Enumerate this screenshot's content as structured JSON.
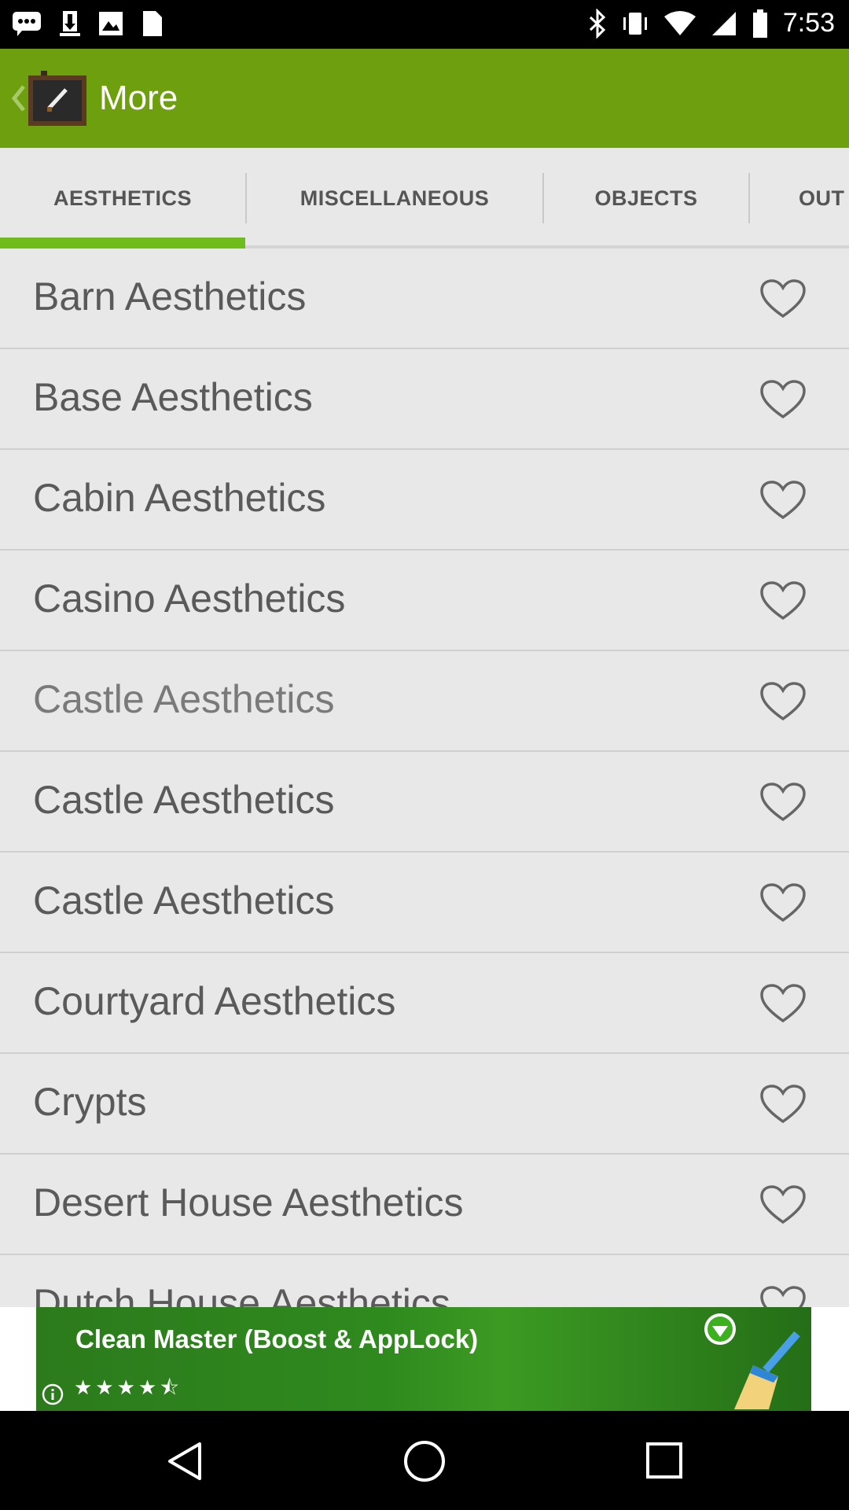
{
  "status_bar": {
    "time": "7:53"
  },
  "action_bar": {
    "title": "More"
  },
  "tabs": [
    {
      "label": "AESTHETICS",
      "active": true
    },
    {
      "label": "MISCELLANEOUS",
      "active": false
    },
    {
      "label": "OBJECTS",
      "active": false
    },
    {
      "label": "OUT",
      "active": false
    }
  ],
  "list": {
    "items": [
      {
        "label": "Barn Aesthetics"
      },
      {
        "label": "Base Aesthetics"
      },
      {
        "label": "Cabin Aesthetics"
      },
      {
        "label": "Casino Aesthetics"
      },
      {
        "label": "Castle Aesthetics"
      },
      {
        "label": "Castle Aesthetics"
      },
      {
        "label": "Castle Aesthetics"
      },
      {
        "label": "Courtyard Aesthetics"
      },
      {
        "label": "Crypts"
      },
      {
        "label": "Desert House Aesthetics"
      },
      {
        "label": "Dutch House Aesthetics"
      }
    ]
  },
  "ad": {
    "title": "Clean Master (Boost & AppLock)",
    "rating": 4.5
  },
  "colors": {
    "action_bar": "#6e9f0e",
    "tab_indicator": "#6fbd1d",
    "list_background": "#e8e8e8"
  }
}
